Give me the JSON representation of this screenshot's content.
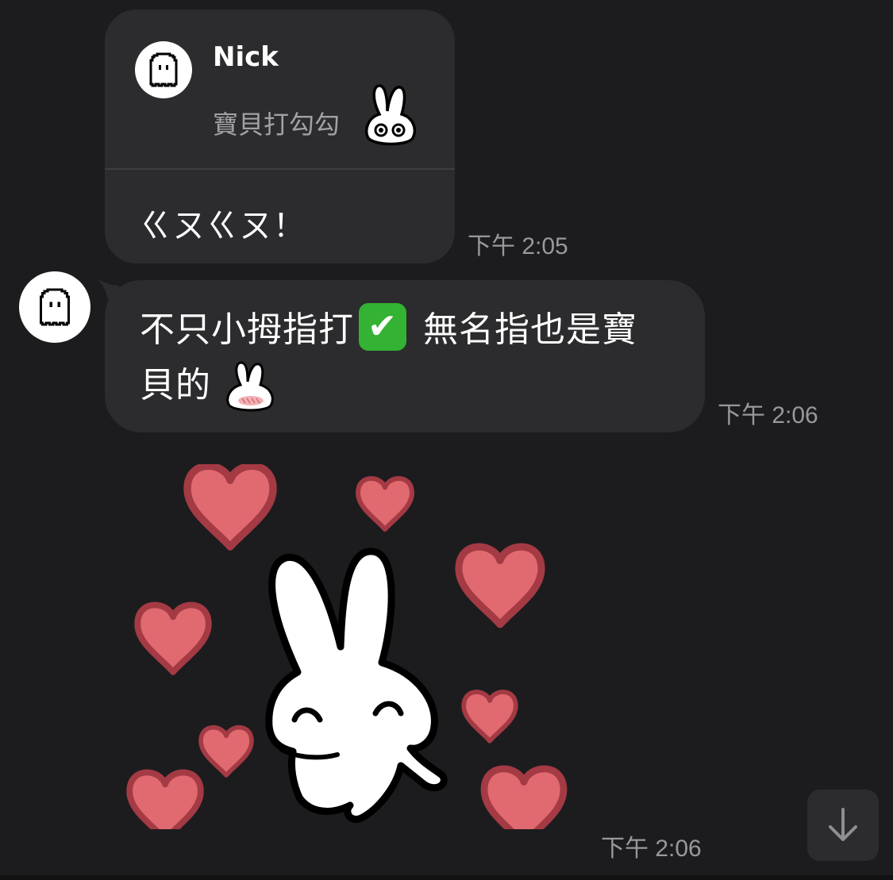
{
  "reply_message": {
    "quoted": {
      "sender_name": "Nick",
      "text": "寶貝打勾勾"
    },
    "text": "ㄍㄡㄍㄡ！",
    "time": "下午 2:05"
  },
  "message2": {
    "line1_before": "不只小拇指打",
    "line1_emoji": "✔",
    "line1_after": " 無名指也是寶",
    "line2": "貝的",
    "time": "下午 2:06"
  },
  "sticker_message": {
    "time": "下午 2:06"
  },
  "icons": {
    "avatar": "ghost-icon",
    "scroll": "arrow-down-icon"
  },
  "colors": {
    "background": "#1c1c1e",
    "bubble": "#2c2c2e",
    "heart_fill": "#e06a70",
    "heart_outline": "#a43a44",
    "check_green": "#34b233"
  }
}
